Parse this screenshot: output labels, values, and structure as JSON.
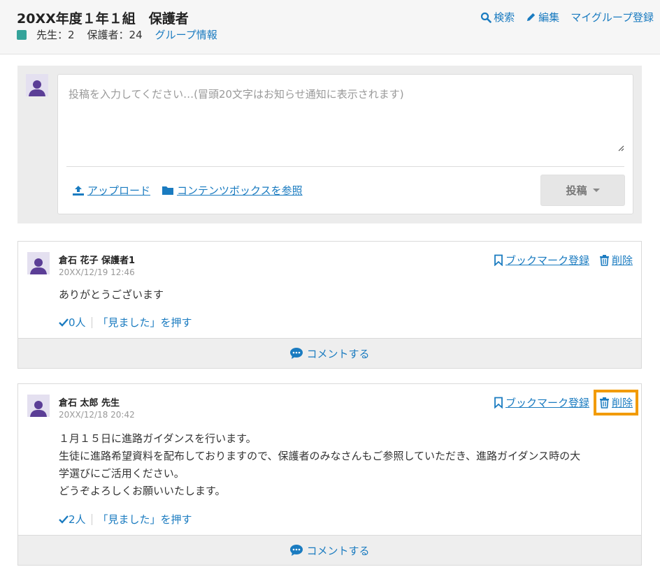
{
  "header": {
    "title": "20XX年度１年１組　保護者",
    "teacher_count": "先生：2",
    "parent_count": "保護者：24",
    "group_info_link": "グループ情報",
    "actions": {
      "search": "検索",
      "edit": "編集",
      "register_group": "マイグループ登録"
    }
  },
  "composer": {
    "placeholder": "投稿を入力してください…(冒頭20文字はお知らせ通知に表示されます)",
    "upload_label": "アップロード",
    "browse_label": "コンテンツボックスを参照",
    "post_button": "投稿"
  },
  "posts": [
    {
      "author": "倉石 花子 保護者1",
      "time": "20XX/12/19 12:46",
      "body": [
        "ありがとうございます"
      ],
      "seen_count": "0人",
      "seen_button": "「見ました」を押す",
      "bookmark_label": "ブックマーク登録",
      "delete_label": "削除",
      "comment_label": "コメントする"
    },
    {
      "author": "倉石 太郎 先生",
      "time": "20XX/12/18 20:42",
      "body": [
        "１月１５日に進路ガイダンスを行います。",
        "生徒に進路希望資料を配布しておりますので、保護者のみなさんもご参照していただき、進路ガイダンス時の大",
        "学選びにご活用ください。",
        "どうぞよろしくお願いいたします。"
      ],
      "seen_count": "2人",
      "seen_button": "「見ました」を押す",
      "bookmark_label": "ブックマーク登録",
      "delete_label": "削除",
      "comment_label": "コメントする"
    }
  ],
  "colors": {
    "accent": "#1a7bc0",
    "group_swatch": "#35a39a",
    "highlight": "#f29b00"
  }
}
